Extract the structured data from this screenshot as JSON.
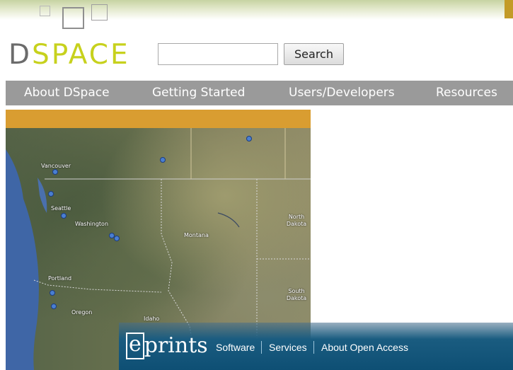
{
  "header": {
    "logo_d": "D",
    "logo_space": "SPACE",
    "search_placeholder": "",
    "search_button_label": "Search"
  },
  "nav": {
    "items": [
      {
        "label": "About DSpace"
      },
      {
        "label": "Getting Started"
      },
      {
        "label": "Users/Developers"
      },
      {
        "label": "Resources"
      }
    ]
  },
  "map": {
    "labels": [
      "Vancouver",
      "Seattle",
      "Washington",
      "Montana",
      "North Dakota",
      "Portland",
      "Oregon",
      "Idaho",
      "South Dakota"
    ]
  },
  "footer": {
    "logo_e": "e",
    "logo_rest": "prints",
    "links": [
      "Software",
      "Services",
      "About Open Access"
    ]
  },
  "colors": {
    "brand_green": "#c7d11d",
    "nav_gray": "#9a9a9a",
    "orange_bar": "#d99d31",
    "footer_blue": "#0e4f74"
  }
}
